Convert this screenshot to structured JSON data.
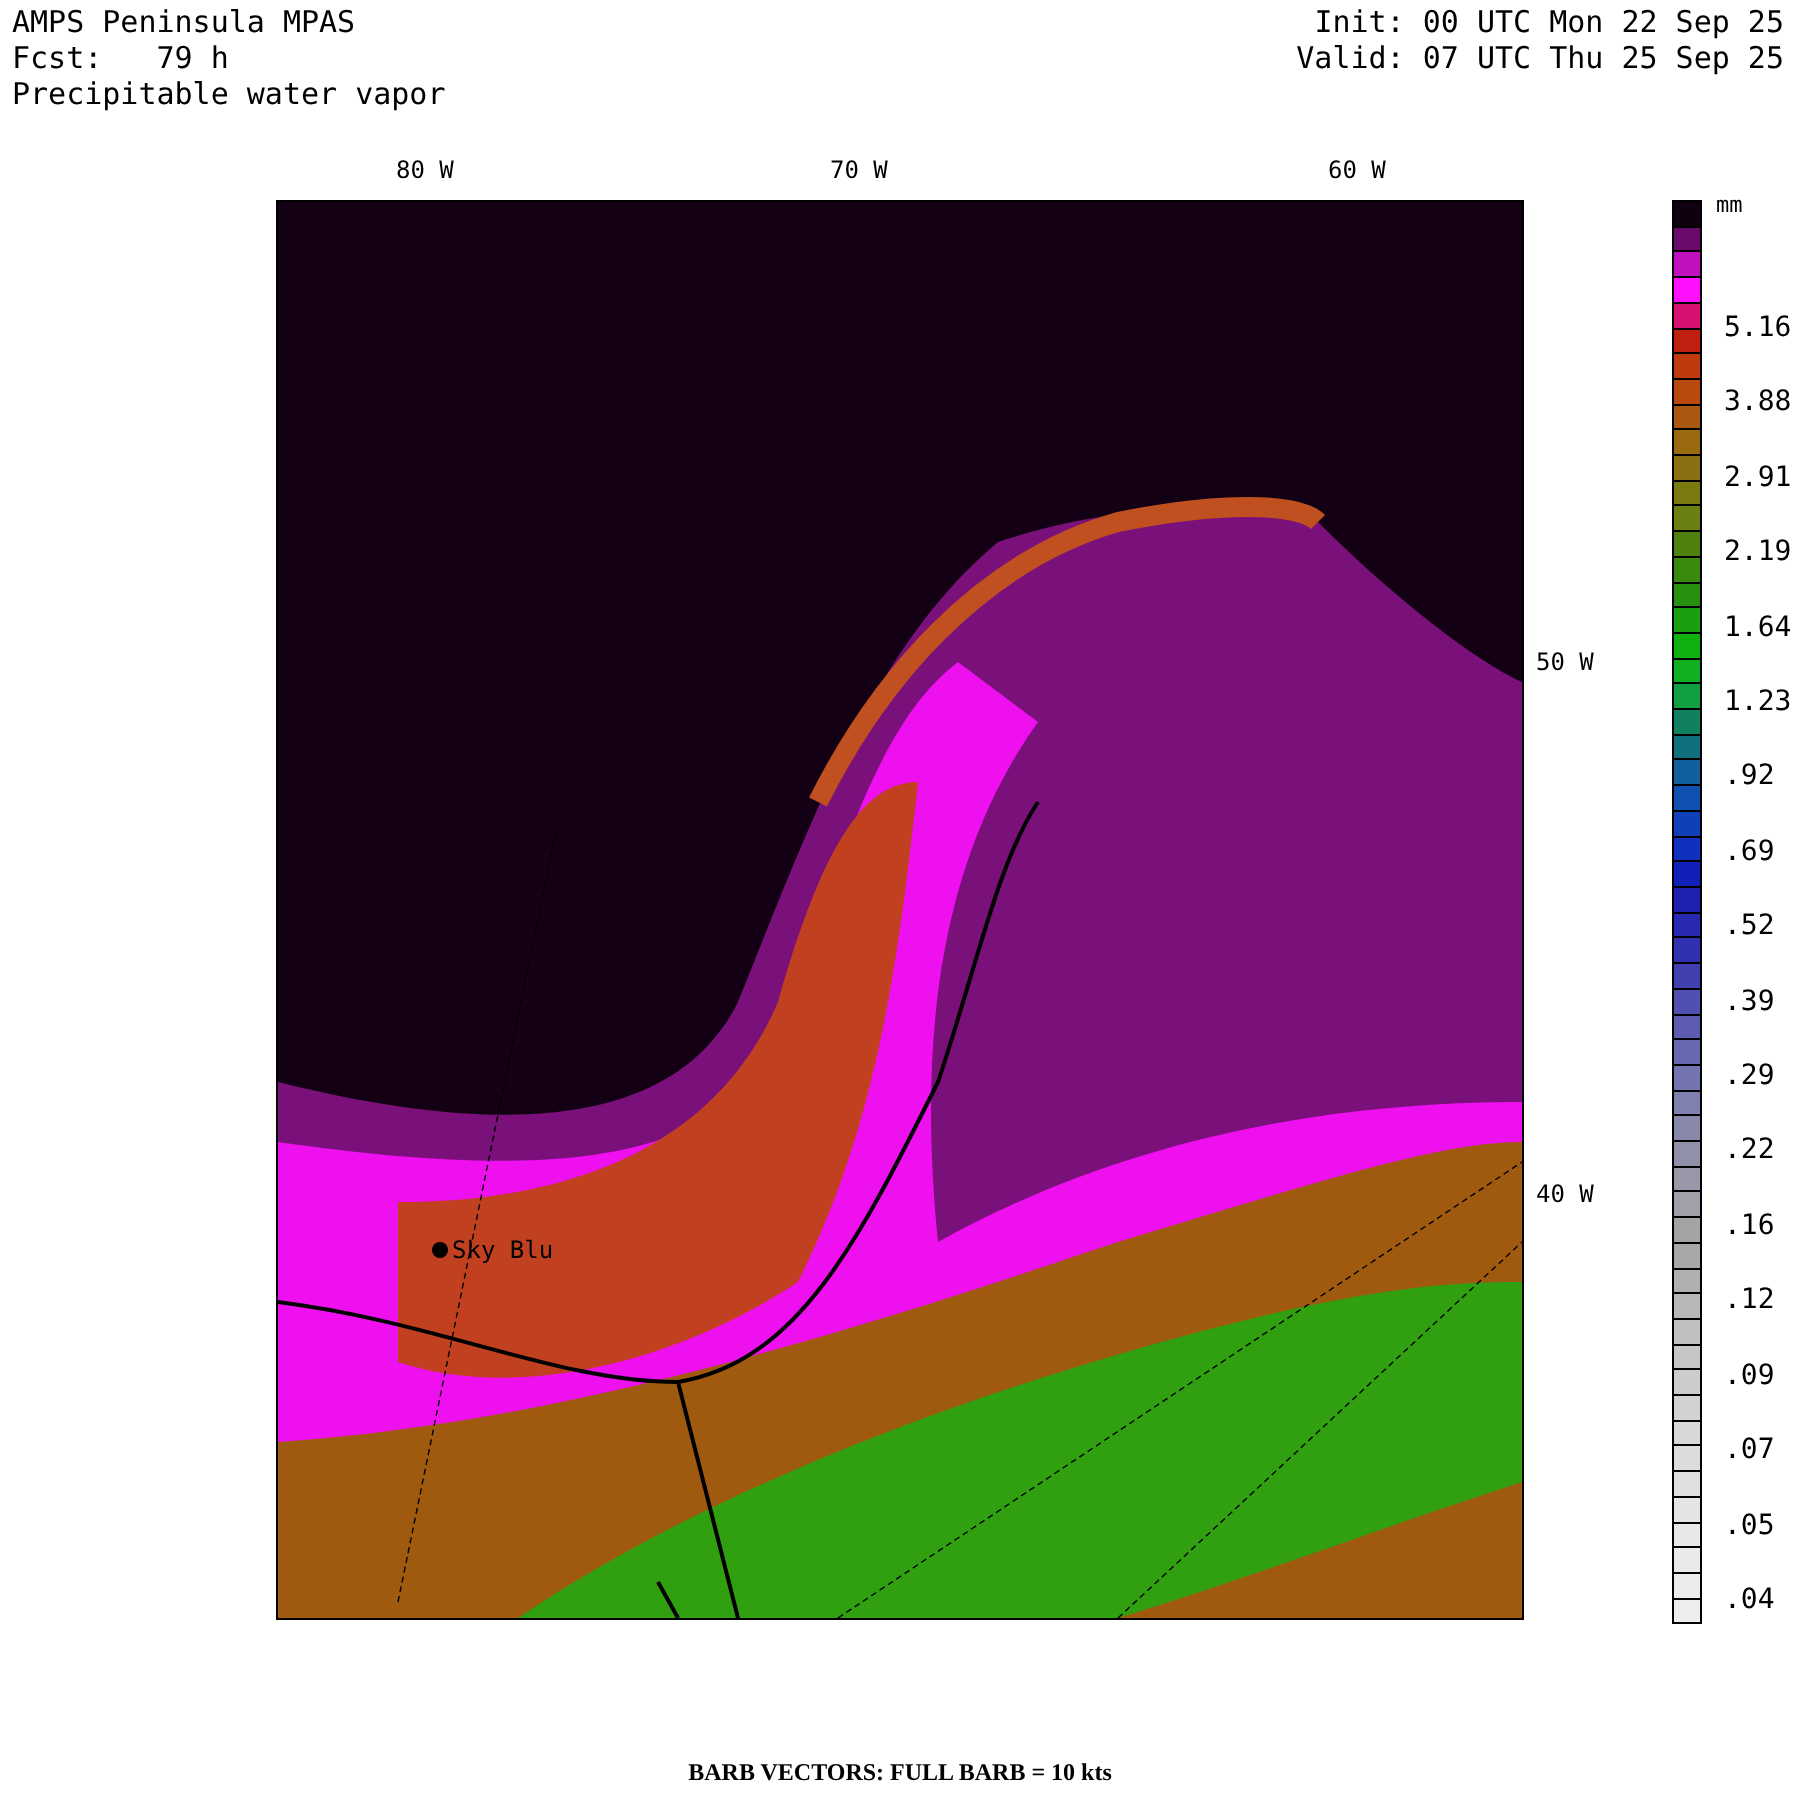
{
  "header": {
    "title": "AMPS Peninsula MPAS",
    "forecast": "Fcst:   79 h",
    "field": "Precipitable water vapor",
    "init": "Init: 00 UTC Mon 22 Sep 25",
    "valid": "Valid: 07 UTC Thu 25 Sep 25"
  },
  "map": {
    "top_labels": [
      "80 W",
      "70 W",
      "60 W"
    ],
    "right_labels": [
      "50 W",
      "40 W"
    ],
    "station": "Sky Blu"
  },
  "legend": {
    "unit": "mm",
    "labels": [
      "5.16",
      "3.88",
      "2.91",
      "2.19",
      "1.64",
      "1.23",
      ".92",
      ".69",
      ".52",
      ".39",
      ".29",
      ".22",
      ".16",
      ".12",
      ".09",
      ".07",
      ".05",
      ".04"
    ],
    "swatches": [
      {
        "color": "#100010"
      },
      {
        "color": "#6a0a6a"
      },
      {
        "color": "#c010c0"
      },
      {
        "color": "#ff10ff"
      },
      {
        "color": "#d81070"
      },
      {
        "color": "#c02010"
      },
      {
        "color": "#c03a10"
      },
      {
        "color": "#b84a10"
      },
      {
        "color": "#a85810"
      },
      {
        "color": "#9a6a10"
      },
      {
        "color": "#8a7010"
      },
      {
        "color": "#7a7a10"
      },
      {
        "color": "#6a8010"
      },
      {
        "color": "#508010"
      },
      {
        "color": "#3a8a10"
      },
      {
        "color": "#289010"
      },
      {
        "color": "#18a010"
      },
      {
        "color": "#10b010"
      },
      {
        "color": "#10b020"
      },
      {
        "color": "#10a040"
      },
      {
        "color": "#108060"
      },
      {
        "color": "#107080"
      },
      {
        "color": "#1060a0"
      },
      {
        "color": "#1050b0"
      },
      {
        "color": "#1040b8"
      },
      {
        "color": "#1030c0"
      },
      {
        "color": "#1020b8"
      },
      {
        "color": "#2020b0"
      },
      {
        "color": "#2828b0"
      },
      {
        "color": "#3030b0"
      },
      {
        "color": "#4040b0"
      },
      {
        "color": "#5050b0"
      },
      {
        "color": "#5c5cb0"
      },
      {
        "color": "#6868b0"
      },
      {
        "color": "#7474b0"
      },
      {
        "color": "#8080b0"
      },
      {
        "color": "#8888a8"
      },
      {
        "color": "#9090a8"
      },
      {
        "color": "#9898a8"
      },
      {
        "color": "#a0a0a8"
      },
      {
        "color": "#a4a4a4"
      },
      {
        "color": "#a8a8a8"
      },
      {
        "color": "#b0b0b0"
      },
      {
        "color": "#b8b8b8"
      },
      {
        "color": "#c0c0c0"
      },
      {
        "color": "#c6c6c6"
      },
      {
        "color": "#cccccc"
      },
      {
        "color": "#d2d2d2"
      },
      {
        "color": "#d8d8d8"
      },
      {
        "color": "#dcdcdc"
      },
      {
        "color": "#e0e0e0"
      },
      {
        "color": "#e4e4e4"
      },
      {
        "color": "#e8e8e8"
      },
      {
        "color": "#eaeaea"
      },
      {
        "color": "#ececec"
      },
      {
        "color": "#eeeeee"
      }
    ]
  },
  "footer": "BARB VECTORS:  FULL BARB = 10 kts"
}
